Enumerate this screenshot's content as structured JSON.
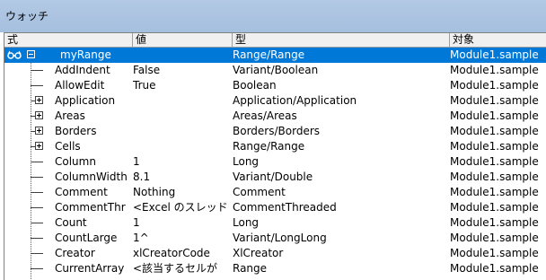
{
  "window": {
    "title": "ウォッチ"
  },
  "columns": {
    "expr": "式",
    "value": "値",
    "type": "型",
    "context": "対象"
  },
  "rows": [
    {
      "name": "myRange",
      "value": "",
      "type": "Range/Range",
      "context": "Module1.sample",
      "expander": "minus",
      "selected": true,
      "level": 0
    },
    {
      "name": "AddIndent",
      "value": "False",
      "type": "Variant/Boolean",
      "context": "Module1.sample",
      "expander": "none",
      "level": 1
    },
    {
      "name": "AllowEdit",
      "value": "True",
      "type": "Boolean",
      "context": "Module1.sample",
      "expander": "none",
      "level": 1
    },
    {
      "name": "Application",
      "value": "",
      "type": "Application/Application",
      "context": "Module1.sample",
      "expander": "plus",
      "level": 1
    },
    {
      "name": "Areas",
      "value": "",
      "type": "Areas/Areas",
      "context": "Module1.sample",
      "expander": "plus",
      "level": 1
    },
    {
      "name": "Borders",
      "value": "",
      "type": "Borders/Borders",
      "context": "Module1.sample",
      "expander": "plus",
      "level": 1
    },
    {
      "name": "Cells",
      "value": "",
      "type": "Range/Range",
      "context": "Module1.sample",
      "expander": "plus",
      "level": 1
    },
    {
      "name": "Column",
      "value": "1",
      "type": "Long",
      "context": "Module1.sample",
      "expander": "none",
      "level": 1
    },
    {
      "name": "ColumnWidth",
      "value": "8.1",
      "type": "Variant/Double",
      "context": "Module1.sample",
      "expander": "none",
      "level": 1
    },
    {
      "name": "Comment",
      "value": "Nothing",
      "type": "Comment",
      "context": "Module1.sample",
      "expander": "none",
      "level": 1
    },
    {
      "name": "CommentThr",
      "value": "<Excel のスレッド",
      "type": "CommentThreaded",
      "context": "Module1.sample",
      "expander": "none",
      "level": 1
    },
    {
      "name": "Count",
      "value": "1",
      "type": "Long",
      "context": "Module1.sample",
      "expander": "none",
      "level": 1
    },
    {
      "name": "CountLarge",
      "value": "1^",
      "type": "Variant/LongLong",
      "context": "Module1.sample",
      "expander": "none",
      "level": 1
    },
    {
      "name": "Creator",
      "value": "xlCreatorCode",
      "type": "XlCreator",
      "context": "Module1.sample",
      "expander": "none",
      "level": 1
    },
    {
      "name": "CurrentArray",
      "value": "<該当するセルが",
      "type": "Range",
      "context": "Module1.sample",
      "expander": "none",
      "level": 1
    }
  ],
  "colors": {
    "titlebar": "#a5bfdf",
    "selection": "#0078d7"
  },
  "icons": {
    "watch": "glasses-icon"
  }
}
